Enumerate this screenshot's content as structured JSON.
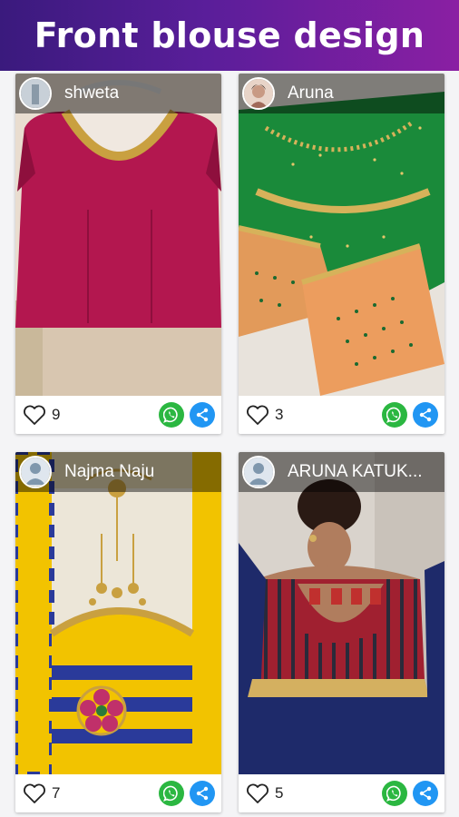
{
  "header": {
    "title": "Front blouse design"
  },
  "posts": [
    {
      "user": "shweta",
      "likes": "9"
    },
    {
      "user": "Aruna",
      "likes": "3"
    },
    {
      "user": "Najma Naju",
      "likes": "7"
    },
    {
      "user": "ARUNA KATUK...",
      "likes": "5"
    }
  ],
  "icons": {
    "like": "heart-outline-icon",
    "whatsapp": "whatsapp-icon",
    "share": "share-icon"
  },
  "colors": {
    "header_start": "#3a1a7d",
    "header_end": "#8a1fa3",
    "whatsapp": "#2bb741",
    "share": "#2196f3"
  }
}
